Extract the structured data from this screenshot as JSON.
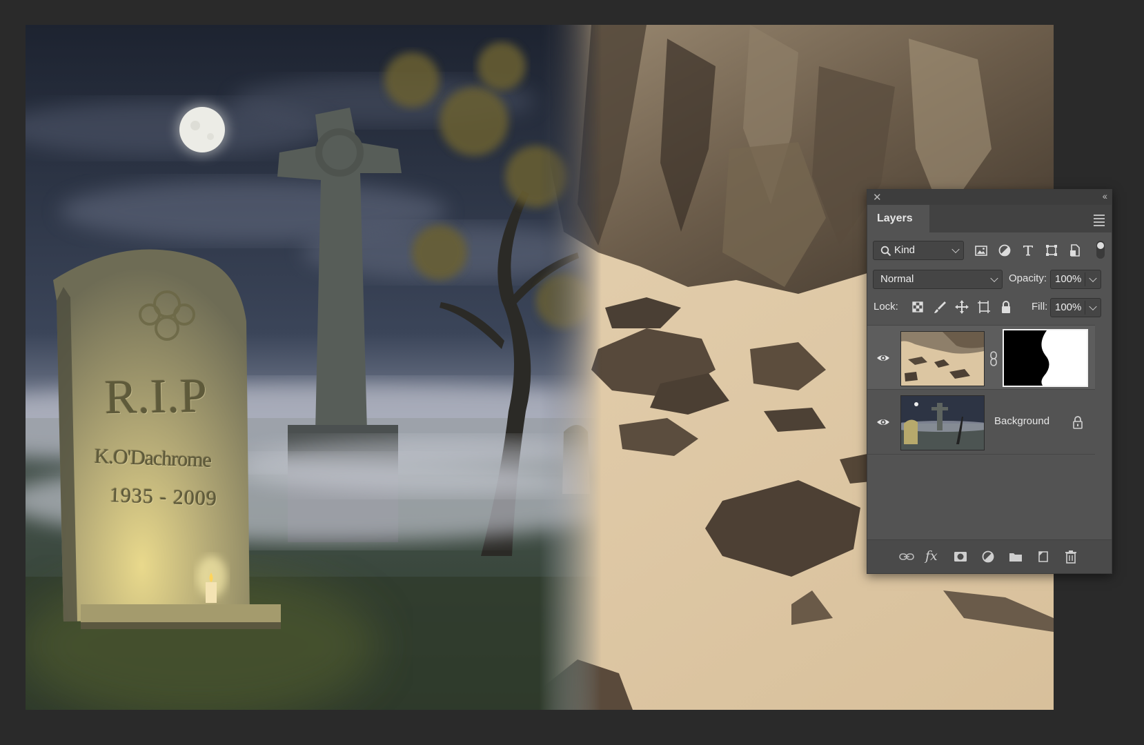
{
  "canvas": {
    "tombstone_title": "R.I.P",
    "tombstone_name": "K.O'Dachrome",
    "tombstone_years": "1935 - 2009"
  },
  "layers_panel": {
    "tab_label": "Layers",
    "filter": {
      "kind_label": "Kind",
      "icons": [
        "image-filter-icon",
        "adjustment-filter-icon",
        "type-filter-icon",
        "shape-filter-icon",
        "smart-object-filter-icon"
      ]
    },
    "blend_mode": "Normal",
    "opacity_label": "Opacity:",
    "opacity_value": "100%",
    "lock_label": "Lock:",
    "lock_icons": [
      "lock-transparent-pixels-icon",
      "lock-image-pixels-icon",
      "lock-position-icon",
      "lock-artboard-icon",
      "lock-all-icon"
    ],
    "fill_label": "Fill:",
    "fill_value": "100%",
    "layers": [
      {
        "name": "",
        "visible": true,
        "has_mask": true,
        "selected": true
      },
      {
        "name": "Background",
        "visible": true,
        "locked": true
      }
    ],
    "footer_icons": [
      "link-layers-icon",
      "fx-icon",
      "add-mask-icon",
      "adjustment-layer-icon",
      "new-group-icon",
      "new-layer-icon",
      "delete-layer-icon"
    ]
  }
}
